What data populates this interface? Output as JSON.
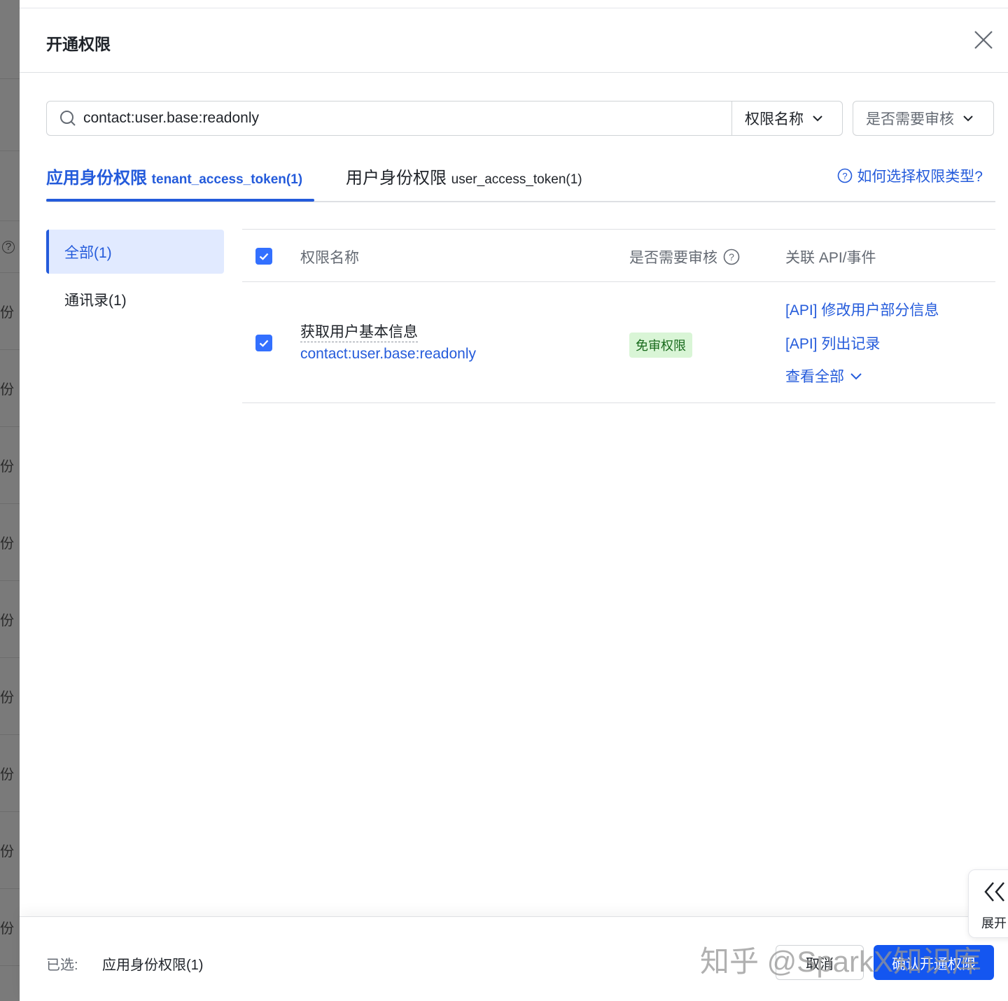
{
  "backdrop": {
    "help_icon": "question-circle-icon",
    "row_char": "份"
  },
  "modal": {
    "title": "开通权限"
  },
  "search": {
    "value": "contact:user.base:readonly",
    "filter1": "权限名称",
    "filter2": "是否需要审核"
  },
  "tabs": [
    {
      "label": "应用身份权限",
      "token": "tenant_access_token(1)"
    },
    {
      "label": "用户身份权限",
      "token": "user_access_token(1)"
    }
  ],
  "help_link": "如何选择权限类型?",
  "sidebar": [
    {
      "label": "全部(1)"
    },
    {
      "label": "通讯录(1)"
    }
  ],
  "table": {
    "headers": {
      "name": "权限名称",
      "review": "是否需要审核",
      "apis": "关联 API/事件"
    },
    "rows": [
      {
        "name": "获取用户基本信息",
        "scope": "contact:user.base:readonly",
        "review": "免审权限",
        "apis": [
          "[API] 修改用户部分信息",
          "[API] 列出记录"
        ],
        "more": "查看全部"
      }
    ]
  },
  "footer": {
    "selected_label": "已选:",
    "selected_value": "应用身份权限(1)",
    "cancel": "取消",
    "confirm": "确认开通权限"
  },
  "expand_label": "展开",
  "watermark": "知乎 @SparkX知识库",
  "colors": {
    "accent": "#245bdb",
    "primary_button": "#1456f0",
    "tag_bg": "#d9f5d6"
  }
}
